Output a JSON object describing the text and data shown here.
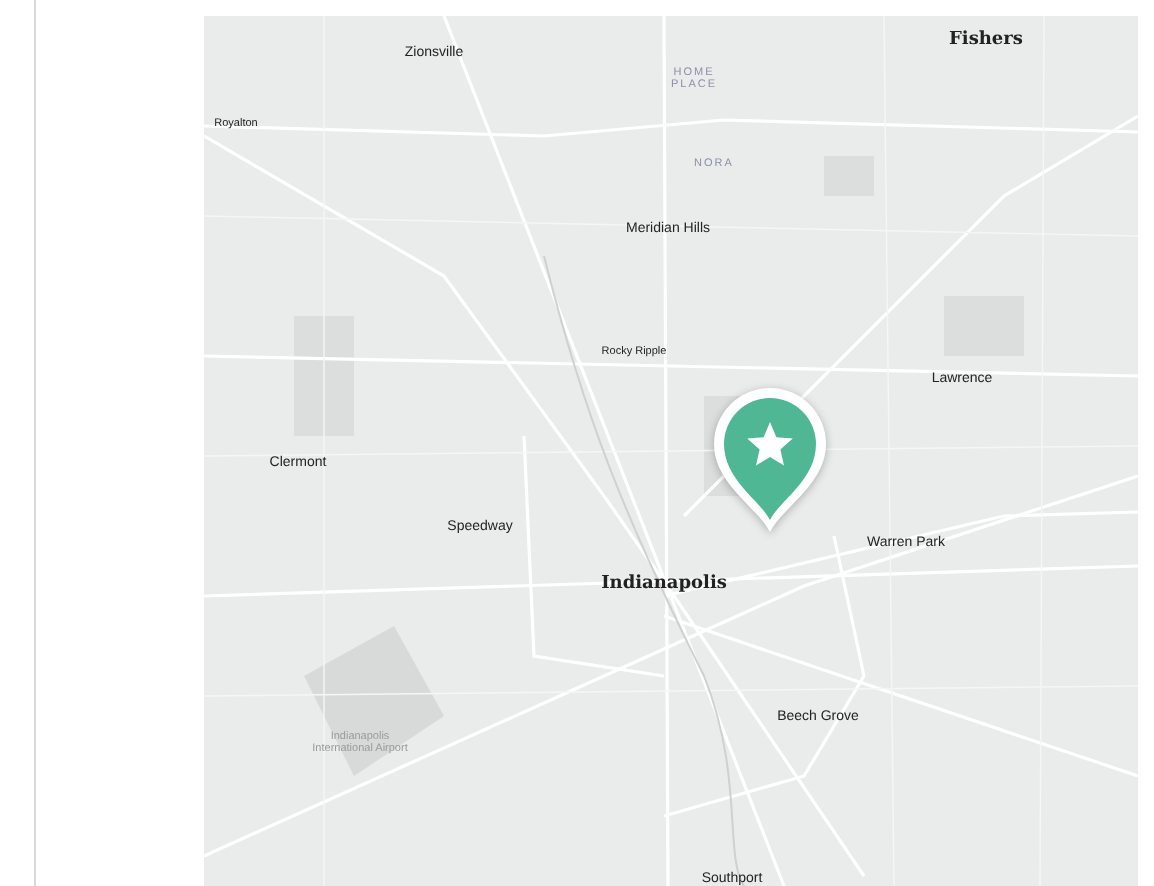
{
  "map": {
    "labels": [
      {
        "text": "Zionsville",
        "kind": "town"
      },
      {
        "text": "Fishers",
        "kind": "city"
      },
      {
        "text": "HOME\nPLACE",
        "kind": "district"
      },
      {
        "text": "Royalton",
        "kind": "small"
      },
      {
        "text": "NORA",
        "kind": "district"
      },
      {
        "text": "Meridian Hills",
        "kind": "town"
      },
      {
        "text": "Rocky Ripple",
        "kind": "small"
      },
      {
        "text": "Lawrence",
        "kind": "town"
      },
      {
        "text": "Clermont",
        "kind": "town"
      },
      {
        "text": "Speedway",
        "kind": "town"
      },
      {
        "text": "Warren Park",
        "kind": "town"
      },
      {
        "text": "Indianapolis",
        "kind": "city"
      },
      {
        "text": "Indianapolis\nInternational Airport",
        "kind": "airport"
      },
      {
        "text": "Beech Grove",
        "kind": "town"
      },
      {
        "text": "Southport",
        "kind": "town"
      }
    ],
    "pin": {
      "color": "#4fb793"
    }
  }
}
